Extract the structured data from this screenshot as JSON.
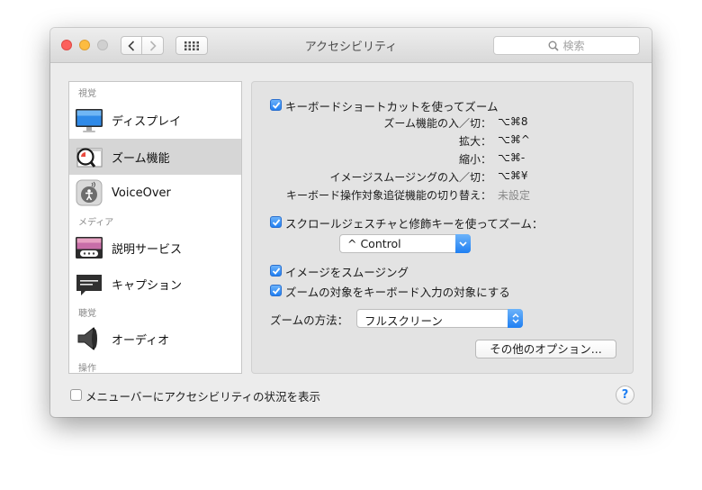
{
  "window": {
    "title": "アクセシビリティ"
  },
  "search": {
    "placeholder": "検索"
  },
  "sidebar": {
    "categories": [
      "視覚",
      "メディア",
      "聴覚",
      "操作"
    ],
    "items": [
      {
        "label": "ディスプレイ",
        "icon": "display-icon"
      },
      {
        "label": "ズーム機能",
        "icon": "zoom-icon",
        "selected": true
      },
      {
        "label": "VoiceOver",
        "icon": "voiceover-icon"
      },
      {
        "label": "説明サービス",
        "icon": "descriptions-icon"
      },
      {
        "label": "キャプション",
        "icon": "captions-icon"
      },
      {
        "label": "オーディオ",
        "icon": "audio-icon"
      }
    ]
  },
  "zoom": {
    "keyboard_shortcuts": {
      "label": "キーボードショートカットを使ってズーム",
      "checked": true
    },
    "shortcuts": [
      {
        "label": "ズーム機能の入／切：",
        "value": "⌥⌘8"
      },
      {
        "label": "拡大：",
        "value": "⌥⌘^"
      },
      {
        "label": "縮小：",
        "value": "⌥⌘-"
      },
      {
        "label": "イメージスムージングの入／切：",
        "value": "⌥⌘¥"
      },
      {
        "label": "キーボード操作対象追従機能の切り替え：",
        "value": "未設定"
      }
    ],
    "scroll_gesture": {
      "label": "スクロールジェスチャと修飾キーを使ってズーム：",
      "checked": true
    },
    "modifier_select": {
      "value": "^ Control"
    },
    "smooth_images": {
      "label": "イメージをスムージング",
      "checked": true
    },
    "follow_focus": {
      "label": "ズームの対象をキーボード入力の対象にする",
      "checked": true
    },
    "zoom_style": {
      "label": "ズームの方法：",
      "value": "フルスクリーン"
    },
    "more_options": {
      "label": "その他のオプション..."
    }
  },
  "footer": {
    "show_menu_status": {
      "label": "メニューバーにアクセシビリティの状況を表示",
      "checked": false
    },
    "help": "?"
  },
  "colors": {
    "accent": "#1f7ff2",
    "selection": "#d6d6d6"
  }
}
